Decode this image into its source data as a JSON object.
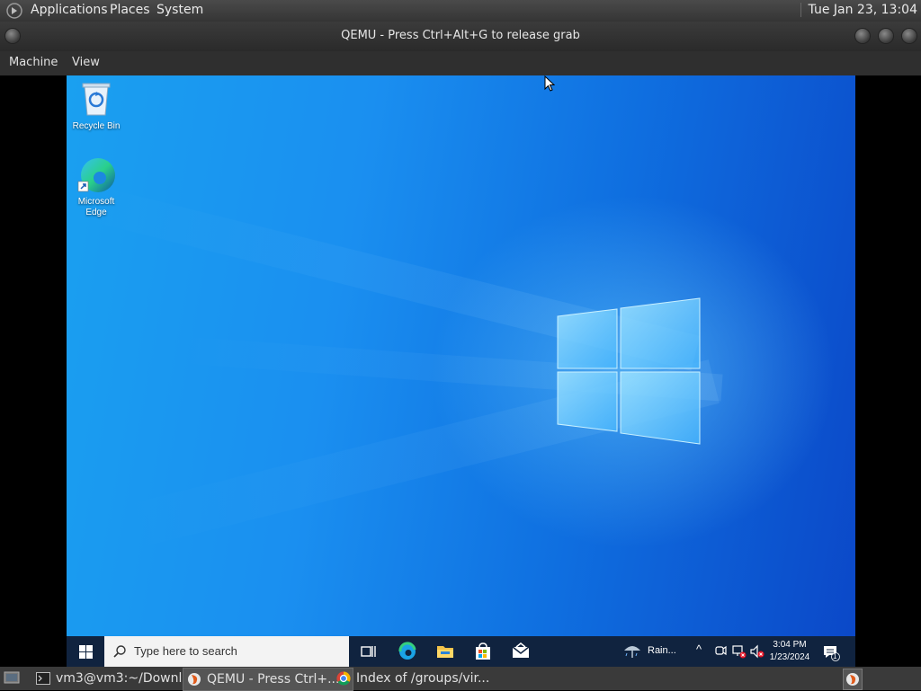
{
  "top_panel": {
    "menus": [
      "Applications",
      "Places",
      "System"
    ],
    "clock": "Tue Jan 23, 13:04"
  },
  "qemu_window": {
    "title": "QEMU - Press Ctrl+Alt+G to release grab",
    "menu": [
      "Machine",
      "View"
    ]
  },
  "desktop": {
    "icons": [
      {
        "label": "Recycle Bin",
        "icon": "recycle-bin-icon"
      },
      {
        "label": "Microsoft\nEdge",
        "icon": "edge-icon"
      }
    ]
  },
  "win_taskbar": {
    "search_placeholder": "Type here to search",
    "weather": "Rain...",
    "time": "3:04 PM",
    "date": "1/23/2024",
    "notification_count": "1"
  },
  "bottom_panel": {
    "tasks": [
      {
        "label": "vm3@vm3:~/Downl...",
        "icon": "terminal-icon"
      },
      {
        "label": "QEMU - Press Ctrl+...",
        "icon": "qemu-icon"
      },
      {
        "label": "Index of /groups/vir...",
        "icon": "chrome-icon"
      }
    ]
  },
  "colors": {
    "wallpaper_blue": "#1a8ff0",
    "win_taskbar": "#10233f",
    "host_panel": "#3a3a3a"
  }
}
